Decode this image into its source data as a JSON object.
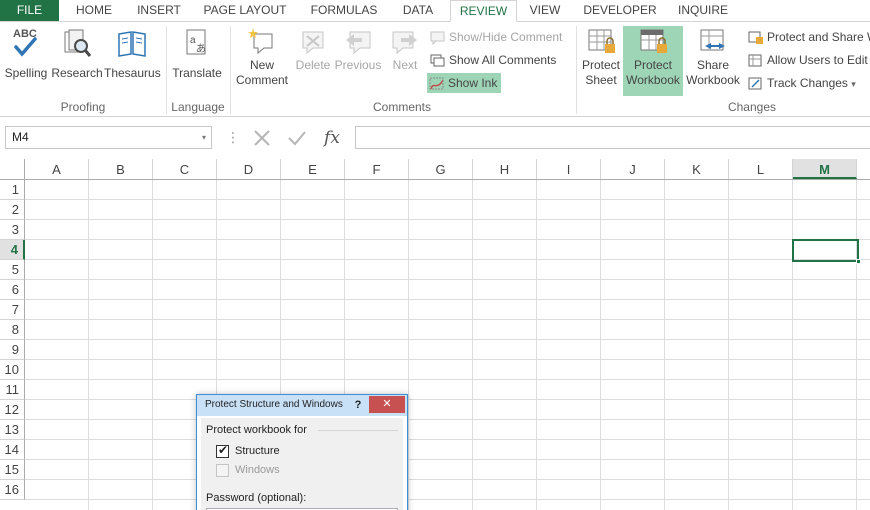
{
  "tabs": [
    {
      "label": "FILE",
      "active": false
    },
    {
      "label": "HOME",
      "active": false
    },
    {
      "label": "INSERT",
      "active": false
    },
    {
      "label": "PAGE LAYOUT",
      "active": false
    },
    {
      "label": "FORMULAS",
      "active": false
    },
    {
      "label": "DATA",
      "active": false
    },
    {
      "label": "REVIEW",
      "active": true
    },
    {
      "label": "VIEW",
      "active": false
    },
    {
      "label": "DEVELOPER",
      "active": false
    },
    {
      "label": "INQUIRE",
      "active": false
    }
  ],
  "ribbon": {
    "proofing": {
      "label": "Proofing",
      "spelling": {
        "label": "Spelling",
        "icon": "abc-check-icon"
      },
      "research": {
        "label": "Research",
        "icon": "research-icon"
      },
      "thesaurus": {
        "label": "Thesaurus",
        "icon": "thesaurus-icon"
      }
    },
    "language": {
      "label": "Language",
      "translate": {
        "label": "Translate",
        "icon": "translate-icon"
      }
    },
    "comments": {
      "label": "Comments",
      "new_comment": {
        "line1": "New",
        "line2": "Comment"
      },
      "delete": {
        "label": "Delete"
      },
      "previous": {
        "label": "Previous"
      },
      "next": {
        "label": "Next"
      },
      "show_hide": {
        "label": "Show/Hide Comment"
      },
      "show_all": {
        "label": "Show All Comments"
      },
      "show_ink": {
        "label": "Show Ink"
      }
    },
    "changes": {
      "label": "Changes",
      "protect_sheet": {
        "line1": "Protect",
        "line2": "Sheet"
      },
      "protect_workbook": {
        "line1": "Protect",
        "line2": "Workbook"
      },
      "share_workbook": {
        "line1": "Share",
        "line2": "Workbook"
      },
      "protect_share": {
        "label": "Protect and Share W"
      },
      "allow_users": {
        "label": "Allow Users to Edit R"
      },
      "track_changes": {
        "label": "Track Changes",
        "caret": "▾"
      }
    }
  },
  "formula_bar": {
    "name_box": "M4",
    "dropdown_glyph": "▾",
    "dots": "⋮",
    "fx_label": "fx",
    "value": ""
  },
  "grid": {
    "columns": [
      "A",
      "B",
      "C",
      "D",
      "E",
      "F",
      "G",
      "H",
      "I",
      "J",
      "K",
      "L",
      "M"
    ],
    "rows": [
      "1",
      "2",
      "3",
      "4",
      "5",
      "6",
      "7",
      "8",
      "9",
      "10",
      "11",
      "12",
      "13",
      "14",
      "15",
      "16"
    ],
    "selected_column": "M",
    "selected_row": "4"
  },
  "dialog": {
    "title": "Protect Structure and Windows",
    "help": "?",
    "close": "✕",
    "section": "Protect workbook for",
    "structure": {
      "label": "Structure",
      "checked": true,
      "check_glyph": "✔"
    },
    "windows": {
      "label": "Windows",
      "checked": false,
      "enabled": false
    },
    "password_label": "Password (optional):",
    "password_value": ""
  },
  "colors": {
    "accent": "#217346",
    "highlight": "#9fd5b7",
    "close_red": "#c75050",
    "dialog_title": "#c9e1f7"
  }
}
